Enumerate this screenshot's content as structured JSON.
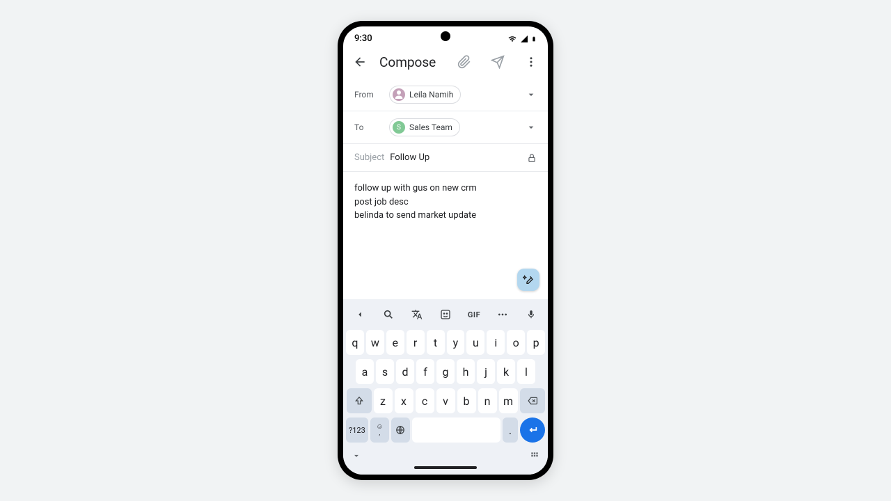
{
  "status": {
    "time": "9:30"
  },
  "appbar": {
    "title": "Compose"
  },
  "from": {
    "label": "From",
    "name": "Leila Namih"
  },
  "to": {
    "label": "To",
    "name": "Sales Team",
    "initial": "S"
  },
  "subject": {
    "label": "Subject",
    "text": "Follow Up"
  },
  "body": {
    "l1": "follow up with gus on new crm",
    "l2": "post job desc",
    "l3": "belinda to send market update"
  },
  "kb": {
    "gif": "GIF",
    "sym": "?123",
    "comma": ",",
    "period": ".",
    "r1": {
      "k0": "q",
      "k1": "w",
      "k2": "e",
      "k3": "r",
      "k4": "t",
      "k5": "y",
      "k6": "u",
      "k7": "i",
      "k8": "o",
      "k9": "p"
    },
    "r2": {
      "k0": "a",
      "k1": "s",
      "k2": "d",
      "k3": "f",
      "k4": "g",
      "k5": "h",
      "k6": "j",
      "k7": "k",
      "k8": "l"
    },
    "r3": {
      "k0": "z",
      "k1": "x",
      "k2": "c",
      "k3": "v",
      "k4": "b",
      "k5": "n",
      "k6": "m"
    }
  }
}
